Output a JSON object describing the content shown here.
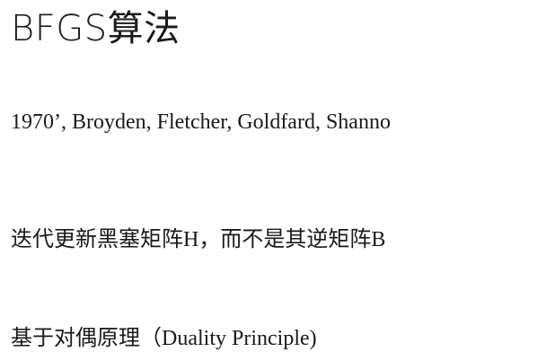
{
  "slide": {
    "title": "BFGS算法",
    "lines": [
      "1970’, Broyden, Fletcher, Goldfard, Shanno",
      "迭代更新黑塞矩阵H，而不是其逆矩阵B",
      "基于对偶原理（Duality Principle)"
    ]
  }
}
